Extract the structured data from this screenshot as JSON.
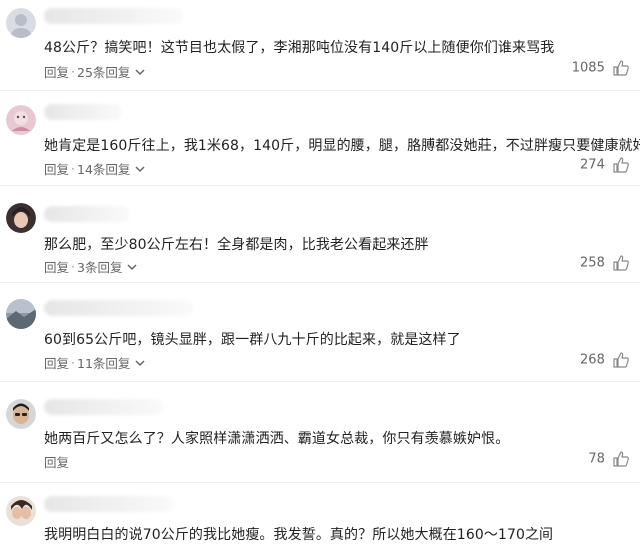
{
  "comments": [
    {
      "text": "48公斤？搞笑吧！这节目也太假了，李湘那吨位没有140斤以上随便你们谁来骂我",
      "reply_label": "回复",
      "reply_count": "25条回复",
      "likes": "1085",
      "name_tail": "̄"
    },
    {
      "text": "她肯定是160斤往上，我1米68，140斤，明显的腰，腿，胳膊都没她莊，不过胖瘦只要健康就好！",
      "reply_label": "回复",
      "reply_count": "14条回复",
      "likes": "274",
      "name_tail": "⺃"
    },
    {
      "text": "那么肥，至少80公斤左右！全身都是肉，比我老公看起来还胖",
      "reply_label": "回复",
      "reply_count": "3条回复",
      "likes": "258"
    },
    {
      "text": "60到65公斤吧，镜头显胖，跟一群八九十斤的比起来，就是这样了",
      "reply_label": "回复",
      "reply_count": "11条回复",
      "likes": "268"
    },
    {
      "text": "她两百斤又怎么了？人家照样潇潇洒洒、霸道女总裁，你只有羡慕嫉妒恨。",
      "reply_label": "回复",
      "reply_count": "",
      "likes": "78"
    },
    {
      "text": "我明明白白的说70公斤的我比她瘦。我发誓。真的？所以她大概在160～170之间",
      "reply_label": "",
      "reply_count": "",
      "likes": ""
    }
  ],
  "colors": {
    "text": "#222222",
    "meta": "#666666",
    "divider": "#ececec"
  },
  "icons": {
    "like": "thumbs-up-icon",
    "expand": "chevron-down-icon"
  }
}
